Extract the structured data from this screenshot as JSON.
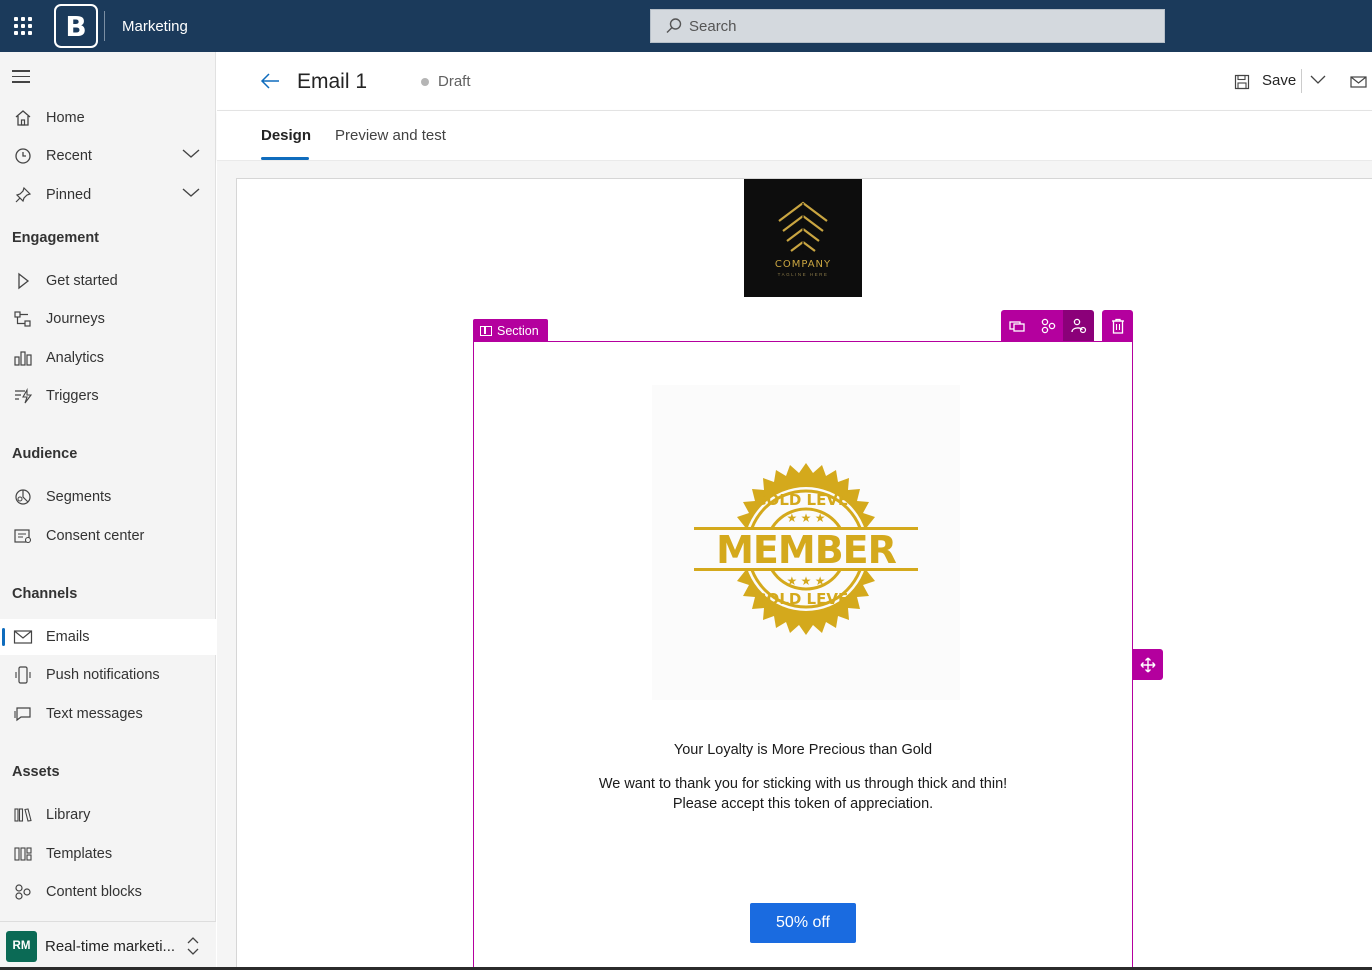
{
  "topbar": {
    "app_name": "Marketing",
    "search_placeholder": "Search",
    "logo_letter": "B"
  },
  "sidebar": {
    "top_items": [
      {
        "label": "Home",
        "icon": "home-icon"
      },
      {
        "label": "Recent",
        "icon": "clock-icon"
      },
      {
        "label": "Pinned",
        "icon": "pin-icon"
      }
    ],
    "sections": [
      {
        "title": "Engagement",
        "items": [
          {
            "label": "Get started",
            "icon": "play-icon"
          },
          {
            "label": "Journeys",
            "icon": "journeys-icon"
          },
          {
            "label": "Analytics",
            "icon": "analytics-icon"
          },
          {
            "label": "Triggers",
            "icon": "triggers-icon"
          }
        ]
      },
      {
        "title": "Audience",
        "items": [
          {
            "label": "Segments",
            "icon": "segments-icon"
          },
          {
            "label": "Consent center",
            "icon": "consent-icon"
          }
        ]
      },
      {
        "title": "Channels",
        "items": [
          {
            "label": "Emails",
            "icon": "mail-icon",
            "active": true
          },
          {
            "label": "Push notifications",
            "icon": "phone-icon"
          },
          {
            "label": "Text messages",
            "icon": "chat-icon"
          }
        ]
      },
      {
        "title": "Assets",
        "items": [
          {
            "label": "Library",
            "icon": "library-icon"
          },
          {
            "label": "Templates",
            "icon": "templates-icon"
          },
          {
            "label": "Content blocks",
            "icon": "content-blocks-icon"
          }
        ]
      }
    ],
    "environment": {
      "initials": "RM",
      "name": "Real-time marketi..."
    }
  },
  "header": {
    "title": "Email 1",
    "status": "Draft",
    "save_label": "Save"
  },
  "tabs": [
    {
      "label": "Design",
      "active": true
    },
    {
      "label": "Preview and test",
      "active": false
    }
  ],
  "canvas": {
    "company_logo": {
      "name": "COMPANY",
      "tagline": "TAGLINE HERE"
    },
    "section_tag": "Section",
    "badge": {
      "top_text": "GOLD LEVEL",
      "center_text": "MEMBER",
      "bottom_text": "GOLD LEVEL"
    },
    "headline": "Your Loyalty is More Precious than Gold",
    "body_line1": "We want to thank you for sticking with us through thick and thin!",
    "body_line2": "Please accept this token of appreciation.",
    "cta_label": "50% off"
  },
  "colors": {
    "topbar": "#1b3a5b",
    "accent": "#0f6cbd",
    "section_magenta": "#b4009e",
    "cta_blue": "#1a6be0",
    "gold": "#d4a91c"
  }
}
